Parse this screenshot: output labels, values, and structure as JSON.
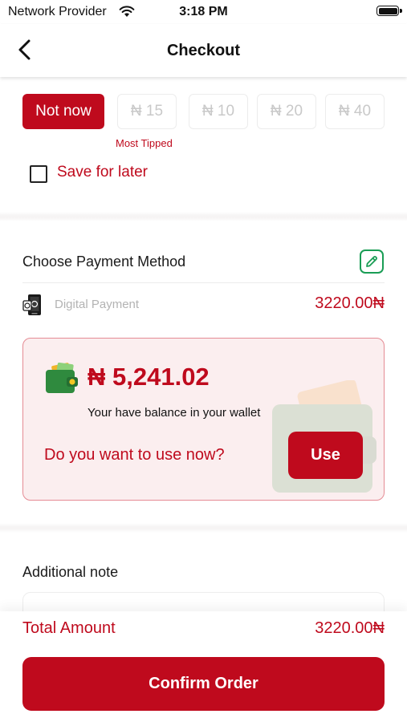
{
  "status_bar": {
    "carrier": "Network Provider",
    "time": "3:18 PM"
  },
  "nav": {
    "title": "Checkout",
    "back_icon": "chevron-left-icon"
  },
  "tips": {
    "options": [
      {
        "label": "Not now",
        "selected": true
      },
      {
        "label": "₦ 15",
        "selected": false
      },
      {
        "label": "₦ 10",
        "selected": false
      },
      {
        "label": "₦ 20",
        "selected": false
      },
      {
        "label": "₦ 40",
        "selected": false
      }
    ],
    "most_tipped_label": "Most Tipped",
    "save_for_later_label": "Save for later",
    "save_for_later_checked": false
  },
  "payment": {
    "title": "Choose Payment Method",
    "method_label": "Digital Payment",
    "amount": "3220.00₦",
    "edit_icon": "pencil-icon"
  },
  "wallet": {
    "balance": "₦ 5,241.02",
    "note": "Your have balance in your wallet",
    "question": "Do you want to use now?",
    "use_label": "Use"
  },
  "note": {
    "title": "Additional note",
    "placeholder": ""
  },
  "footer": {
    "total_label": "Total Amount",
    "total_amount": "3220.00₦",
    "confirm_label": "Confirm Order"
  },
  "colors": {
    "brand": "#bf0a1d",
    "accent_green": "#1a9d55",
    "card_bg": "#fbeeef",
    "card_border": "#e58b94"
  }
}
